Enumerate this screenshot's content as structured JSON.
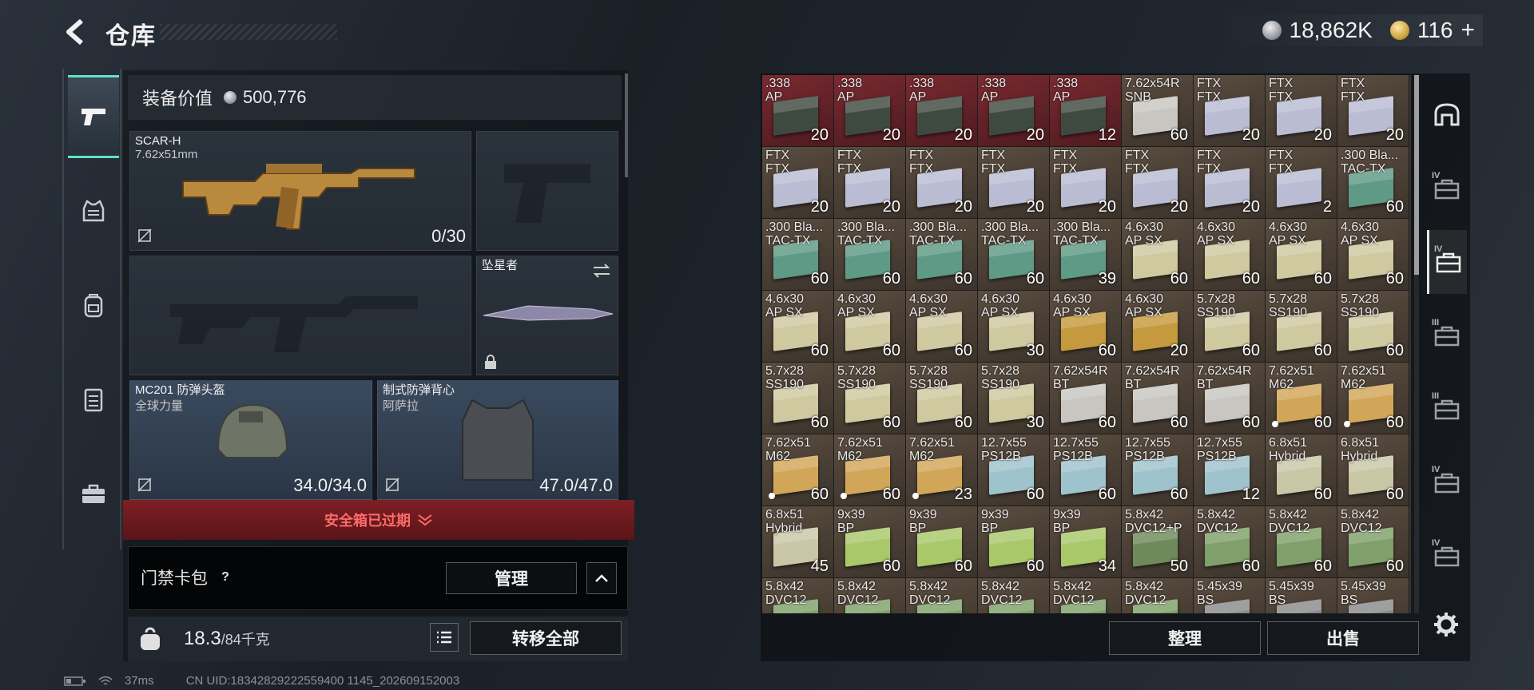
{
  "header": {
    "title": "仓库",
    "currency_silver": "18,862K",
    "currency_gold": "116",
    "gold_add": "+"
  },
  "rail": {
    "categories": [
      "weapons",
      "armor-vest",
      "backpack",
      "chest-rig",
      "case"
    ]
  },
  "equipment": {
    "value_label": "装备价值",
    "value": "500,776",
    "primary": {
      "name": "SCAR-H",
      "caliber": "7.62x51mm",
      "ammo": "0/30"
    },
    "melee": {
      "name": "坠星者"
    },
    "helmet": {
      "name": "MC201 防弹头盔",
      "sub": "全球力量",
      "durability": "34.0/34.0"
    },
    "vest": {
      "name": "制式防弹背心",
      "sub": "阿萨拉",
      "durability": "47.0/47.0"
    }
  },
  "safebox": {
    "label": "安全箱已过期"
  },
  "cardpack": {
    "label": "门禁卡包",
    "help": "?",
    "manage": "管理"
  },
  "weight": {
    "current": "18.3",
    "max": "/84千克",
    "kg_badge": "KG"
  },
  "transfer_all": "转移全部",
  "status": {
    "ping": "37ms",
    "uid": "CN UID:18342829222559400 1145_202609152003"
  },
  "storage": {
    "sort": "整理",
    "sell": "出售",
    "items": [
      {
        "n": ".338\nAP",
        "q": "20",
        "c": "#3e4a3f",
        "r": true
      },
      {
        "n": ".338\nAP",
        "q": "20",
        "c": "#3e4a3f",
        "r": true
      },
      {
        "n": ".338\nAP",
        "q": "20",
        "c": "#3e4a3f",
        "r": true
      },
      {
        "n": ".338\nAP",
        "q": "20",
        "c": "#3e4a3f",
        "r": true
      },
      {
        "n": ".338\nAP",
        "q": "12",
        "c": "#3e4a3f",
        "r": true
      },
      {
        "n": "7.62x54R\nSNB",
        "q": "60",
        "c": "#c9c6c2"
      },
      {
        "n": "FTX\nFTX",
        "q": "20",
        "c": "#b9bcd2"
      },
      {
        "n": "FTX\nFTX",
        "q": "20",
        "c": "#b9bcd2"
      },
      {
        "n": "FTX\nFTX",
        "q": "20",
        "c": "#b9bcd2"
      },
      {
        "n": "FTX\nFTX",
        "q": "20",
        "c": "#b9bcd2"
      },
      {
        "n": "FTX\nFTX",
        "q": "20",
        "c": "#b9bcd2"
      },
      {
        "n": "FTX\nFTX",
        "q": "20",
        "c": "#b9bcd2"
      },
      {
        "n": "FTX\nFTX",
        "q": "20",
        "c": "#b9bcd2"
      },
      {
        "n": "FTX\nFTX",
        "q": "20",
        "c": "#b9bcd2"
      },
      {
        "n": "FTX\nFTX",
        "q": "20",
        "c": "#b9bcd2"
      },
      {
        "n": "FTX\nFTX",
        "q": "20",
        "c": "#b9bcd2"
      },
      {
        "n": "FTX\nFTX",
        "q": "2",
        "c": "#b9bcd2"
      },
      {
        "n": ".300 Bla...\nTAC-TX",
        "q": "60",
        "c": "#5e9a86"
      },
      {
        "n": ".300 Bla...\nTAC-TX",
        "q": "60",
        "c": "#5e9a86"
      },
      {
        "n": ".300 Bla...\nTAC-TX",
        "q": "60",
        "c": "#5e9a86"
      },
      {
        "n": ".300 Bla...\nTAC-TX",
        "q": "60",
        "c": "#5e9a86"
      },
      {
        "n": ".300 Bla...\nTAC-TX",
        "q": "60",
        "c": "#5e9a86"
      },
      {
        "n": ".300 Bla...\nTAC-TX",
        "q": "39",
        "c": "#5e9a86"
      },
      {
        "n": "4.6x30\nAP SX",
        "q": "60",
        "c": "#cfc9a0"
      },
      {
        "n": "4.6x30\nAP SX",
        "q": "60",
        "c": "#cfc9a0"
      },
      {
        "n": "4.6x30\nAP SX",
        "q": "60",
        "c": "#cfc9a0"
      },
      {
        "n": "4.6x30\nAP SX",
        "q": "60",
        "c": "#cfc9a0"
      },
      {
        "n": "4.6x30\nAP SX",
        "q": "60",
        "c": "#cfc9a0"
      },
      {
        "n": "4.6x30\nAP SX",
        "q": "60",
        "c": "#cfc9a0"
      },
      {
        "n": "4.6x30\nAP SX",
        "q": "60",
        "c": "#cfc9a0"
      },
      {
        "n": "4.6x30\nAP SX",
        "q": "30",
        "c": "#cfc9a0"
      },
      {
        "n": "4.6x30\nAP SX",
        "q": "60",
        "c": "#c59a3e"
      },
      {
        "n": "4.6x30\nAP SX",
        "q": "20",
        "c": "#c59a3e"
      },
      {
        "n": "5.7x28\nSS190",
        "q": "60",
        "c": "#cfc9a0"
      },
      {
        "n": "5.7x28\nSS190",
        "q": "60",
        "c": "#cfc9a0"
      },
      {
        "n": "5.7x28\nSS190",
        "q": "60",
        "c": "#cfc9a0"
      },
      {
        "n": "5.7x28\nSS190",
        "q": "60",
        "c": "#cfc9a0"
      },
      {
        "n": "5.7x28\nSS190",
        "q": "60",
        "c": "#cfc9a0"
      },
      {
        "n": "5.7x28\nSS190",
        "q": "60",
        "c": "#cfc9a0"
      },
      {
        "n": "5.7x28\nSS190",
        "q": "30",
        "c": "#cfc9a0"
      },
      {
        "n": "7.62x54R\nBT",
        "q": "60",
        "c": "#c9c6c2"
      },
      {
        "n": "7.62x54R\nBT",
        "q": "60",
        "c": "#c9c6c2"
      },
      {
        "n": "7.62x54R\nBT",
        "q": "60",
        "c": "#c9c6c2"
      },
      {
        "n": "7.62x51\nM62",
        "q": "60",
        "c": "#d2a658",
        "d": true
      },
      {
        "n": "7.62x51\nM62",
        "q": "60",
        "c": "#d2a658",
        "d": true
      },
      {
        "n": "7.62x51\nM62",
        "q": "60",
        "c": "#d2a658",
        "d": true
      },
      {
        "n": "7.62x51\nM62",
        "q": "60",
        "c": "#d2a658",
        "d": true
      },
      {
        "n": "7.62x51\nM62",
        "q": "23",
        "c": "#d2a658",
        "d": true
      },
      {
        "n": "12.7x55\nPS12B",
        "q": "60",
        "c": "#9fc3cc"
      },
      {
        "n": "12.7x55\nPS12B",
        "q": "60",
        "c": "#9fc3cc"
      },
      {
        "n": "12.7x55\nPS12B",
        "q": "60",
        "c": "#9fc3cc"
      },
      {
        "n": "12.7x55\nPS12B",
        "q": "12",
        "c": "#9fc3cc"
      },
      {
        "n": "6.8x51\nHybrid",
        "q": "60",
        "c": "#c9c6a6"
      },
      {
        "n": "6.8x51\nHybrid",
        "q": "60",
        "c": "#c9c6a6"
      },
      {
        "n": "6.8x51\nHybrid",
        "q": "45",
        "c": "#c9c6a6"
      },
      {
        "n": "9x39\nBP",
        "q": "60",
        "c": "#a8c86a"
      },
      {
        "n": "9x39\nBP",
        "q": "60",
        "c": "#a8c86a"
      },
      {
        "n": "9x39\nBP",
        "q": "60",
        "c": "#a8c86a"
      },
      {
        "n": "9x39\nBP",
        "q": "34",
        "c": "#a8c86a"
      },
      {
        "n": "5.8x42\nDVC12+P",
        "q": "50",
        "c": "#6f8a5a"
      },
      {
        "n": "5.8x42\nDVC12",
        "q": "60",
        "c": "#7fa06a"
      },
      {
        "n": "5.8x42\nDVC12",
        "q": "60",
        "c": "#7fa06a"
      },
      {
        "n": "5.8x42\nDVC12",
        "q": "60",
        "c": "#7fa06a"
      },
      {
        "n": "5.8x42\nDVC12",
        "q": "",
        "c": "#7fa06a"
      },
      {
        "n": "5.8x42\nDVC12",
        "q": "",
        "c": "#7fa06a"
      },
      {
        "n": "5.8x42\nDVC12",
        "q": "",
        "c": "#7fa06a"
      },
      {
        "n": "5.8x42\nDVC12",
        "q": "",
        "c": "#7fa06a"
      },
      {
        "n": "5.8x42\nDVC12",
        "q": "",
        "c": "#7fa06a"
      },
      {
        "n": "5.8x42\nDVC12",
        "q": "",
        "c": "#7fa06a"
      },
      {
        "n": "5.45x39\nBS",
        "q": "",
        "c": "#8a8a8a"
      },
      {
        "n": "5.45x39\nBS",
        "q": "",
        "c": "#8a8a8a"
      },
      {
        "n": "5.45x39\nBS",
        "q": "",
        "c": "#8a8a8a"
      }
    ]
  },
  "container_tabs": [
    {
      "icon": "helmet-icon",
      "level": ""
    },
    {
      "icon": "vest-icon",
      "level": "IV"
    },
    {
      "icon": "case-icon",
      "level": "IV"
    },
    {
      "icon": "case-icon",
      "level": "III"
    },
    {
      "icon": "case-icon",
      "level": "III"
    },
    {
      "icon": "case-icon",
      "level": "IV"
    },
    {
      "icon": "case-icon",
      "level": "IV"
    }
  ]
}
